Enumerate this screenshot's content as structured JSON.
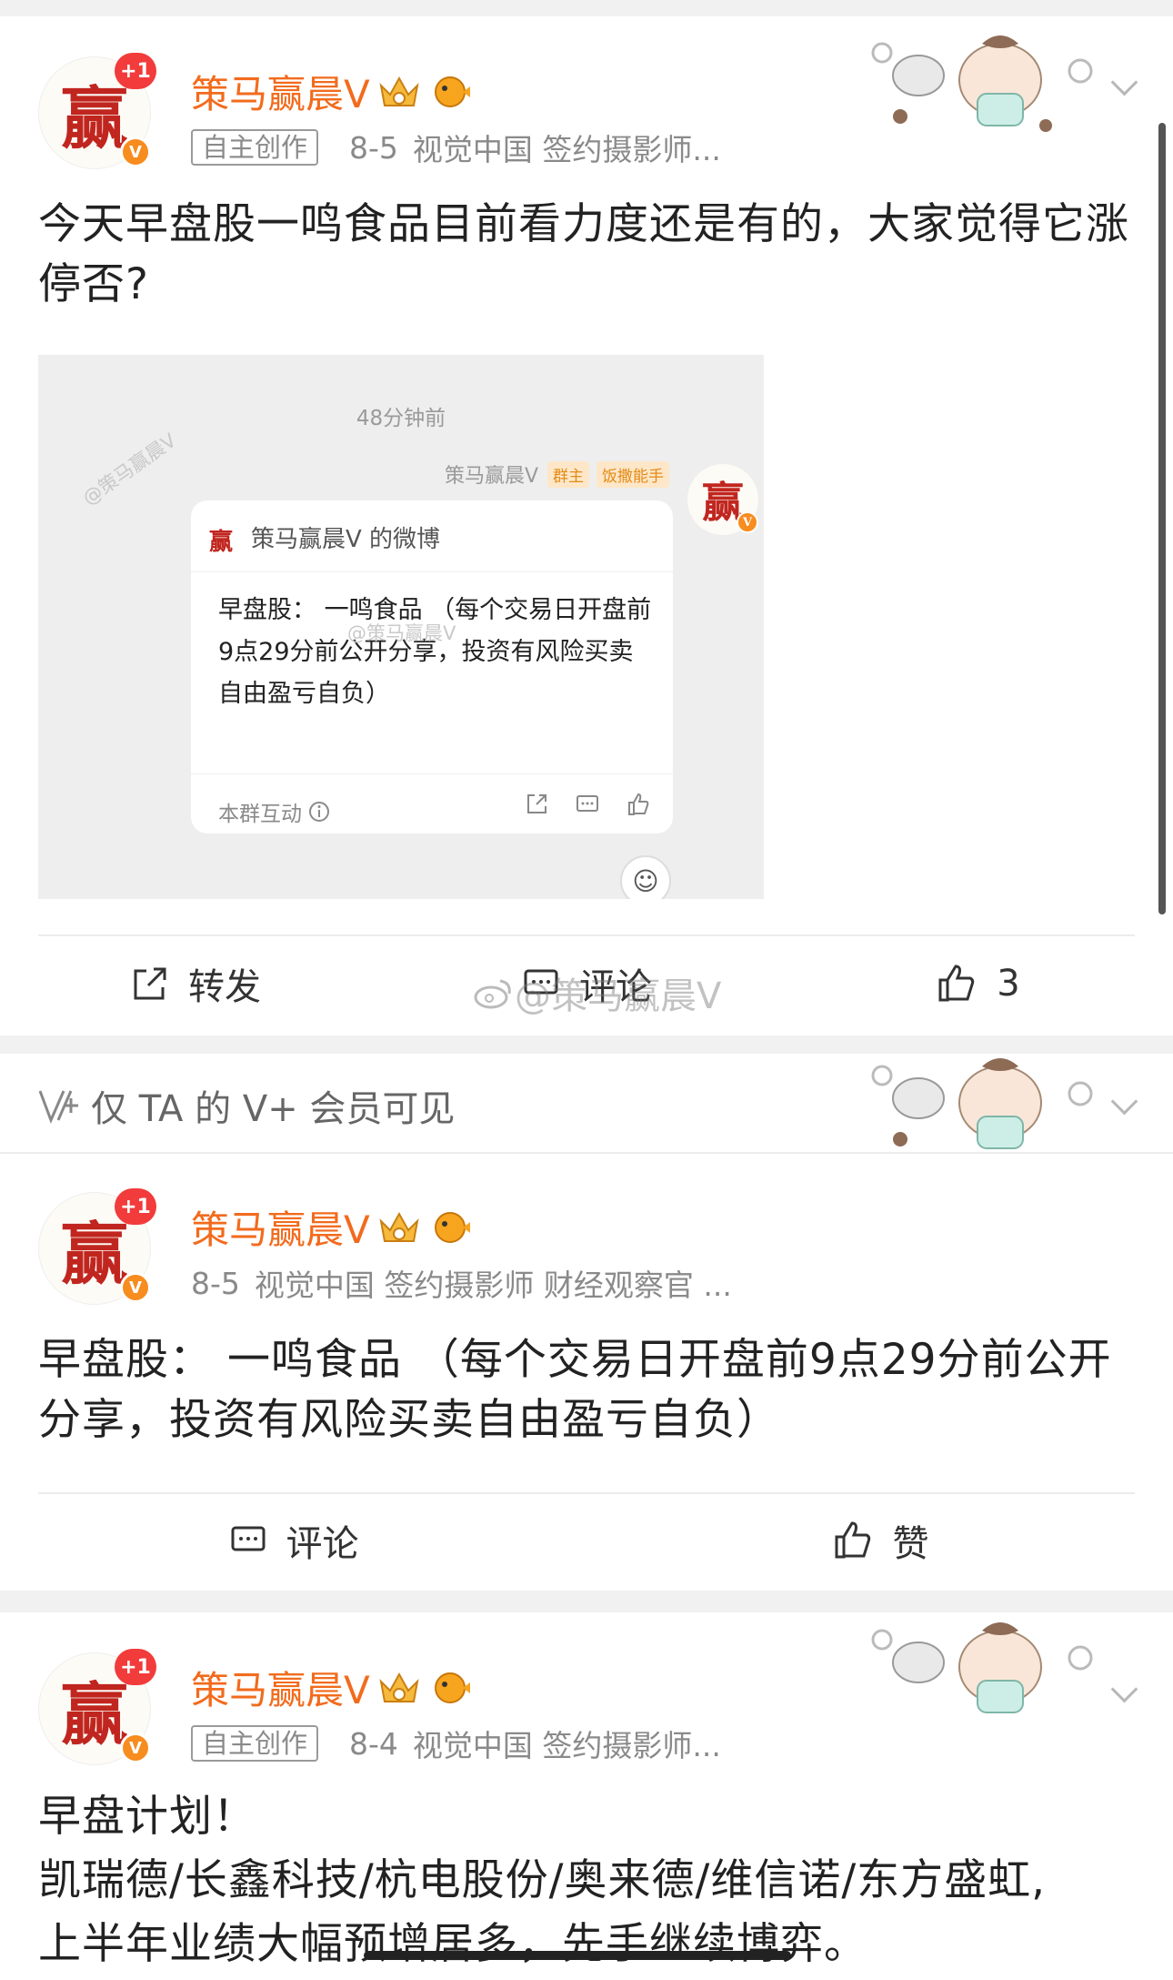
{
  "posts": [
    {
      "author": "策马赢晨V",
      "avatar_char": "赢",
      "plus_badge": "+1",
      "verify_badge": "V",
      "tag": "自主创作",
      "date": "8-5",
      "source": "视觉中国 签约摄影师...",
      "text": "今天早盘股一鸣食品目前看力度还是有的，大家觉得它涨停否?",
      "actions": {
        "repost": "转发",
        "comment": "评论",
        "like_count": "3"
      }
    },
    {
      "vip_notice": "仅 TA 的 V+ 会员可见",
      "author": "策马赢晨V",
      "avatar_char": "赢",
      "plus_badge": "+1",
      "verify_badge": "V",
      "date": "8-5",
      "source": "视觉中国 签约摄影师 财经观察官 ...",
      "text": "早盘股：  一鸣食品              （每个交易日开盘前9点29分前公开分享，投资有风险买卖自由盈亏自负）",
      "actions": {
        "comment": "评论",
        "like": "赞"
      }
    },
    {
      "author": "策马赢晨V",
      "avatar_char": "赢",
      "plus_badge": "+1",
      "verify_badge": "V",
      "tag": "自主创作",
      "date": "8-4",
      "source": "视觉中国 签约摄影师...",
      "text_line1": "早盘计划！",
      "text_line2": "凯瑞德/长鑫科技/杭电股份/奥来德/维信诺/东方盛虹,",
      "text_line3": "上半年业绩大幅预增居多，先手继续博弈。"
    }
  ],
  "embedded": {
    "time": "48分钟前",
    "sender": "策马赢晨V",
    "badge_owner": "群主",
    "badge_title": "饭撒能手",
    "card_title": "策马赢晨V 的微博",
    "card_text": "早盘股：  一鸣食品              （每个交易日开盘前9点29分前公开分享，投资有风险买卖自由盈亏自负）",
    "card_footer": "本群互动",
    "watermark1": "@策马赢晨V",
    "watermark2": "@策马赢晨V"
  },
  "watermark": "@策马赢晨V",
  "colors": {
    "brand_orange": "#f26b1d",
    "badge_red": "#f23b3b",
    "verify_orange": "#f78c1f"
  }
}
